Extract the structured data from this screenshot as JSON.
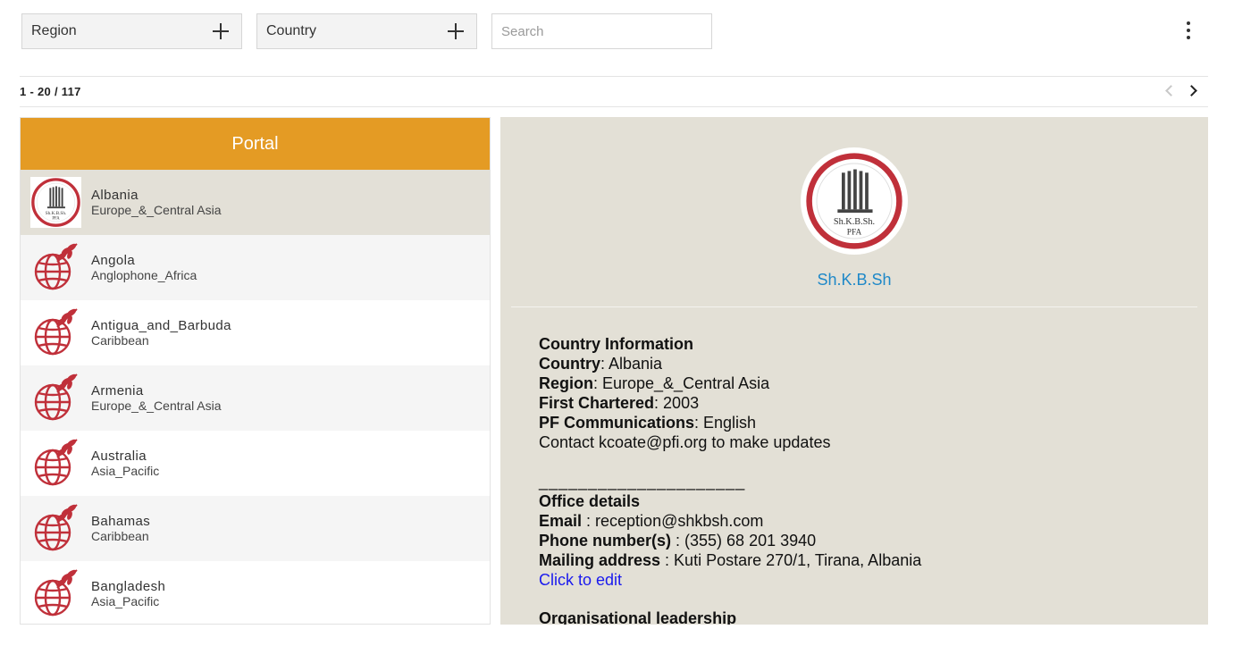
{
  "filters": {
    "region_label": "Region",
    "country_label": "Country",
    "search_placeholder": "Search"
  },
  "pagination": {
    "range_text": "1 - 20 / 117"
  },
  "list": {
    "header": "Portal",
    "items": [
      {
        "name": "Albania",
        "region": "Europe_&_Central Asia",
        "thumb": "shkbsh-logo",
        "selected": true
      },
      {
        "name": "Angola",
        "region": "Anglophone_Africa",
        "thumb": "globe-wheat-icon"
      },
      {
        "name": "Antigua_and_Barbuda",
        "region": "Caribbean",
        "thumb": "globe-wheat-icon"
      },
      {
        "name": "Armenia",
        "region": "Europe_&_Central Asia",
        "thumb": "globe-wheat-icon"
      },
      {
        "name": "Australia",
        "region": "Asia_Pacific",
        "thumb": "globe-wheat-icon"
      },
      {
        "name": "Bahamas",
        "region": "Caribbean",
        "thumb": "globe-wheat-icon"
      },
      {
        "name": "Bangladesh",
        "region": "Asia_Pacific",
        "thumb": "globe-wheat-icon"
      }
    ]
  },
  "logo_text": {
    "line1": "Sh.K.B.Sh.",
    "line2": "PFA"
  },
  "detail": {
    "org_name": "Sh.K.B.Sh",
    "section_country": "Country Information",
    "country_label": "Country",
    "country_value": ": Albania",
    "region_label": "Region",
    "region_value": ": Europe_&_Central Asia",
    "chartered_label": "First Chartered",
    "chartered_value": ": 2003",
    "comms_label": "PF Communications",
    "comms_value": ": English",
    "contact_note": "Contact kcoate@pfi.org to make updates",
    "divider": "_____________________",
    "section_office": "Office details",
    "email_label": "Email",
    "email_value": " : reception@shkbsh.com",
    "phone_label": "Phone number(s)",
    "phone_value": " : (355) 68 201 3940",
    "mail_label": "Mailing address",
    "mail_value": " : Kuti Postare 270/1, Tirana, Albania",
    "edit_link": "Click to edit",
    "section_leadership": "Organisational leadership"
  },
  "colors": {
    "header_orange": "#e49b24",
    "selected_row": "#e3e0d7",
    "detail_bg": "#e3e0d6",
    "link_blue": "#1e88c8",
    "logo_red": "#c0303a"
  }
}
